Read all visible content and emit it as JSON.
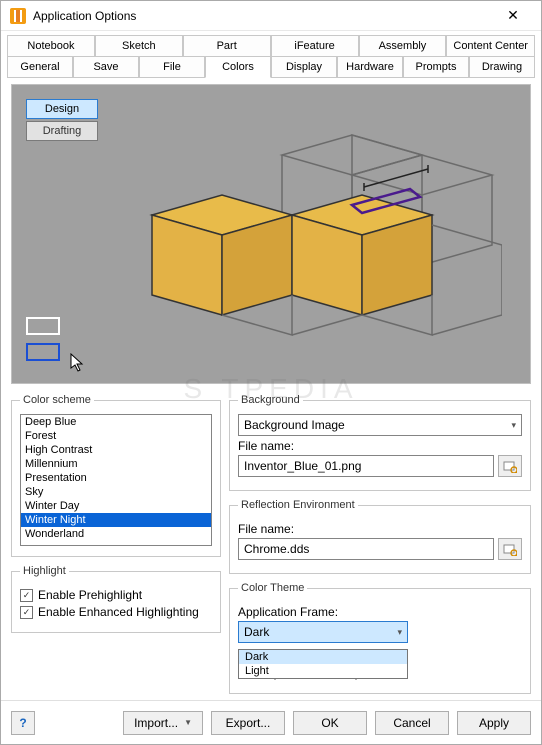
{
  "window": {
    "title": "Application Options"
  },
  "tabs_row1": [
    "Notebook",
    "Sketch",
    "Part",
    "iFeature",
    "Assembly",
    "Content Center"
  ],
  "tabs_row2": [
    "General",
    "Save",
    "File",
    "Colors",
    "Display",
    "Hardware",
    "Prompts",
    "Drawing"
  ],
  "active_tab": "Colors",
  "preview": {
    "design_label": "Design",
    "drafting_label": "Drafting"
  },
  "color_scheme": {
    "legend": "Color scheme",
    "items": [
      "Deep Blue",
      "Forest",
      "High Contrast",
      "Millennium",
      "Presentation",
      "Sky",
      "Winter Day",
      "Winter Night",
      "Wonderland"
    ],
    "selected": "Winter Night"
  },
  "highlight": {
    "legend": "Highlight",
    "prehighlight": "Enable Prehighlight",
    "enhanced": "Enable Enhanced Highlighting"
  },
  "background": {
    "legend": "Background",
    "combo_value": "Background Image",
    "filename_label": "File name:",
    "filename_value": "Inventor_Blue_01.png"
  },
  "reflection": {
    "legend": "Reflection Environment",
    "filename_label": "File name:",
    "filename_value": "Chrome.dds"
  },
  "color_theme": {
    "legend": "Color Theme",
    "frame_label": "Application Frame:",
    "frame_value": "Dark",
    "options": [
      "Dark",
      "Light"
    ]
  },
  "footer": {
    "help": "?",
    "import": "Import...",
    "export": "Export...",
    "ok": "OK",
    "cancel": "Cancel",
    "apply": "Apply"
  },
  "watermark": "S    TPEDIA"
}
